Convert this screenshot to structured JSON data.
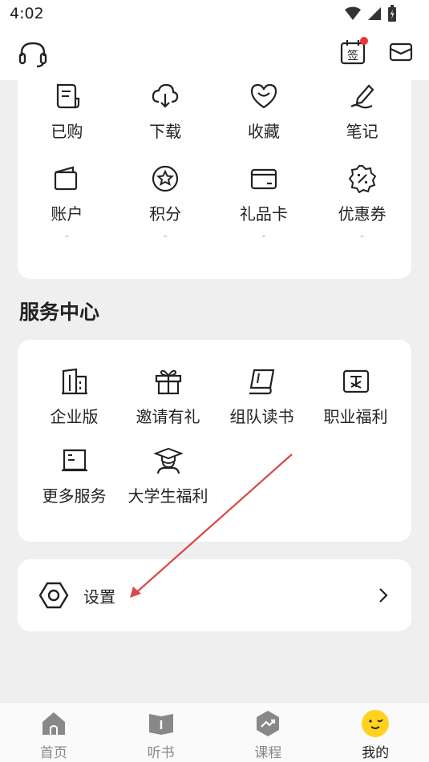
{
  "status_bar": {
    "time": "4:02"
  },
  "assets": {
    "items": [
      {
        "label": "已购",
        "icon": "receipt-icon"
      },
      {
        "label": "下载",
        "icon": "cloud-download-icon"
      },
      {
        "label": "收藏",
        "icon": "heart-icon"
      },
      {
        "label": "笔记",
        "icon": "pen-icon"
      },
      {
        "label": "账户",
        "icon": "wallet-icon",
        "sub": "-"
      },
      {
        "label": "积分",
        "icon": "star-icon",
        "sub": "-"
      },
      {
        "label": "礼品卡",
        "icon": "gift-card-icon",
        "sub": "-"
      },
      {
        "label": "优惠券",
        "icon": "coupon-icon",
        "sub": "-"
      }
    ]
  },
  "services": {
    "title": "服务中心",
    "items": [
      {
        "label": "企业版",
        "icon": "building-icon"
      },
      {
        "label": "邀请有礼",
        "icon": "gift-box-icon"
      },
      {
        "label": "组队读书",
        "icon": "flag-icon"
      },
      {
        "label": "职业福利",
        "icon": "voucher-icon"
      },
      {
        "label": "更多服务",
        "icon": "book-icon"
      },
      {
        "label": "大学生福利",
        "icon": "graduate-icon"
      }
    ]
  },
  "settings": {
    "label": "设置"
  },
  "bottom_nav": {
    "items": [
      {
        "label": "首页",
        "icon": "home-icon"
      },
      {
        "label": "听书",
        "icon": "audiobook-icon"
      },
      {
        "label": "课程",
        "icon": "course-icon"
      },
      {
        "label": "我的",
        "icon": "smiley-icon",
        "active": true
      }
    ]
  },
  "colors": {
    "accent_yellow": "#ffd21f",
    "notification_red": "#ee3333",
    "annotation_red": "#d84a4a"
  }
}
